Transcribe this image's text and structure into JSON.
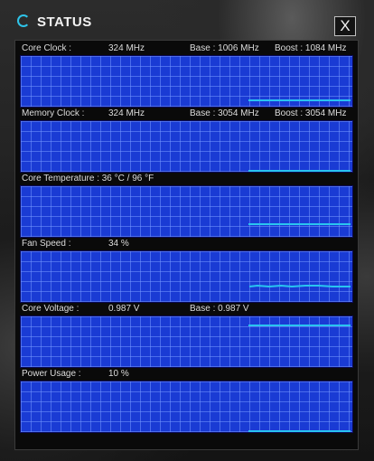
{
  "window": {
    "title": "STATUS",
    "close_label": "X"
  },
  "monitors": [
    {
      "id": "core-clock",
      "label": "Core Clock :",
      "value": "324 MHz",
      "base": "Base : 1006 MHz",
      "boost": "Boost : 1084 MHz"
    },
    {
      "id": "memory-clock",
      "label": "Memory Clock :",
      "value": "324 MHz",
      "base": "Base : 3054 MHz",
      "boost": "Boost : 3054 MHz"
    },
    {
      "id": "core-temperature",
      "label": "Core Temperature : 36 °C / 96 °F"
    },
    {
      "id": "fan-speed",
      "label": "Fan Speed :",
      "value": "34 %"
    },
    {
      "id": "core-voltage",
      "label": "Core Voltage :",
      "value": "0.987 V",
      "base": "Base : 0.987 V"
    },
    {
      "id": "power-usage",
      "label": "Power Usage :",
      "value": "10 %"
    }
  ],
  "colors": {
    "graph_bg": "#1a3bd4",
    "grid": "#7396ff",
    "trace": "#29c4f0",
    "accent": "#2ec3e8"
  }
}
